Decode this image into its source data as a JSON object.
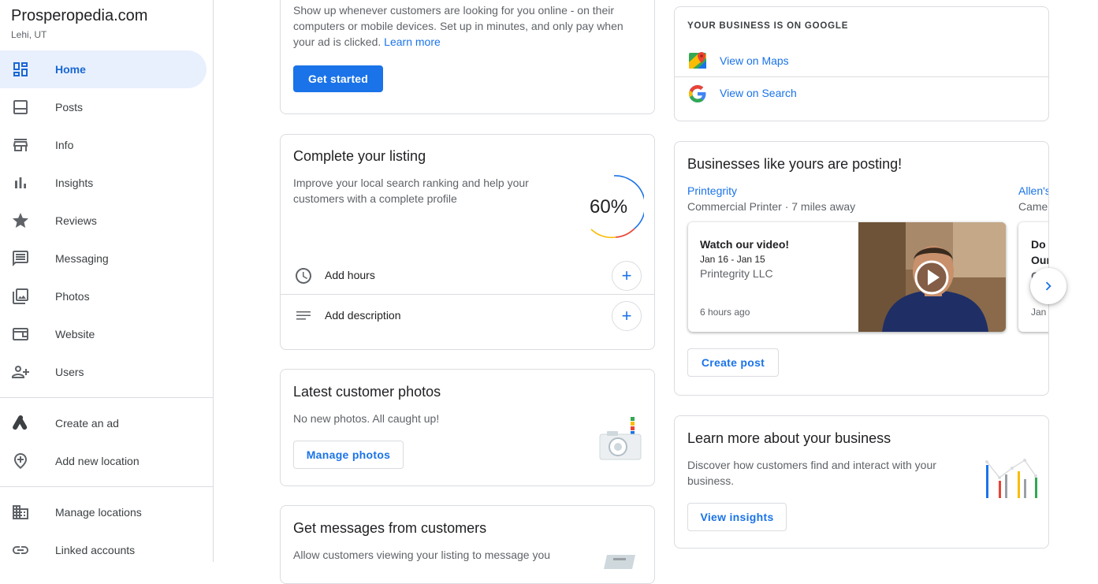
{
  "sidebar": {
    "business_name": "Prosperopedia.com",
    "location": "Lehi, UT",
    "items": [
      {
        "label": "Home",
        "icon": "dashboard-icon"
      },
      {
        "label": "Posts",
        "icon": "posts-icon"
      },
      {
        "label": "Info",
        "icon": "storefront-icon"
      },
      {
        "label": "Insights",
        "icon": "bar-chart-icon"
      },
      {
        "label": "Reviews",
        "icon": "star-icon"
      },
      {
        "label": "Messaging",
        "icon": "message-icon"
      },
      {
        "label": "Photos",
        "icon": "photos-icon"
      },
      {
        "label": "Website",
        "icon": "website-icon"
      },
      {
        "label": "Users",
        "icon": "add-user-icon"
      }
    ],
    "secondary": [
      {
        "label": "Create an ad",
        "icon": "google-ads-icon"
      },
      {
        "label": "Add new location",
        "icon": "add-location-icon"
      }
    ],
    "tertiary": [
      {
        "label": "Manage locations",
        "icon": "building-icon"
      },
      {
        "label": "Linked accounts",
        "icon": "link-icon"
      }
    ]
  },
  "ads_card": {
    "text": "Show up whenever customers are looking for you online - on their computers or mobile devices. Set up in minutes, and only pay when your ad is clicked.",
    "learn_more": "Learn more",
    "button": "Get started"
  },
  "listing_card": {
    "title": "Complete your listing",
    "text": "Improve your local search ranking and help your customers with a complete profile",
    "percent": "60%",
    "progress": 0.6,
    "rows": [
      {
        "label": "Add hours",
        "icon": "clock-icon"
      },
      {
        "label": "Add description",
        "icon": "description-icon"
      }
    ]
  },
  "photos_card": {
    "title": "Latest customer photos",
    "text": "No new photos. All caught up!",
    "button": "Manage photos"
  },
  "messages_card": {
    "title": "Get messages from customers",
    "text": "Allow customers viewing your listing to message you"
  },
  "google_card": {
    "heading": "YOUR BUSINESS IS ON GOOGLE",
    "maps_link": "View on Maps",
    "search_link": "View on Search"
  },
  "posting_card": {
    "title": "Businesses like yours are posting!",
    "business": "Printegrity",
    "business_meta": "Commercial Printer · 7 miles away",
    "business2": "Allen's",
    "business2_meta": "Camer",
    "post": {
      "title": "Watch our video!",
      "dates": "Jan 16 - Jan 15",
      "author": "Printegrity LLC",
      "time": "6 hours ago"
    },
    "post2": {
      "line1": "Do y",
      "line2": "Our",
      "line3": "Can",
      "time": "Jan"
    },
    "button": "Create post"
  },
  "insights_card": {
    "title": "Learn more about your business",
    "text": "Discover how customers find and interact with your business.",
    "button": "View insights"
  },
  "colors": {
    "accent": "#1a73e8",
    "active_bg": "#e8f0fe",
    "border": "#dadce0"
  }
}
